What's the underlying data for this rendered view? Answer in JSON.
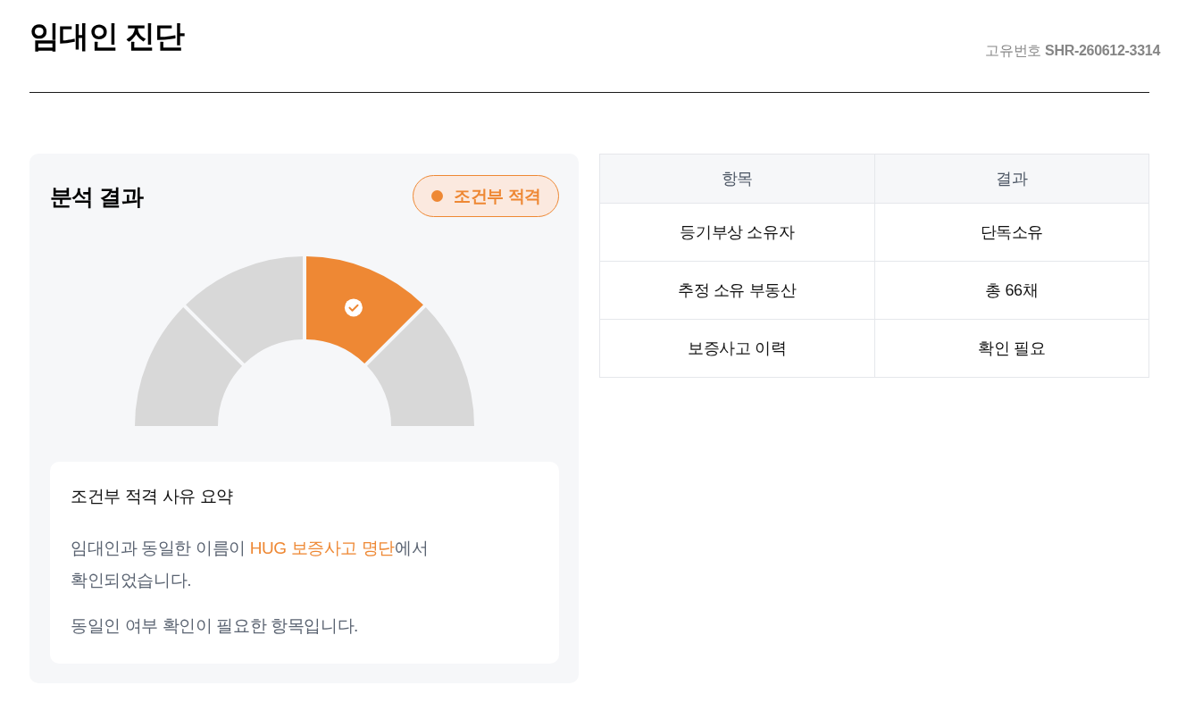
{
  "header": {
    "title": "임대인 진단",
    "reference": "고유번호 **SHR-260612-3314**"
  },
  "analysis": {
    "title": "분석 결과",
    "status": {
      "label": "조건부 적격",
      "kind": "conditional"
    },
    "gauge": {
      "segments": [
        {
          "selected": false
        },
        {
          "selected": false
        },
        {
          "selected": true
        },
        {
          "selected": false
        }
      ]
    },
    "summary": {
      "title": "조건부 적격 사유 요약",
      "paragraphs": [
        [
          {
            "text": "임대인과 동일한 이름이 ",
            "highlight": false
          },
          {
            "text": "HUG 보증사고 명단",
            "highlight": true
          },
          {
            "text": "에서 확인되었습니다.",
            "highlight": false
          }
        ],
        [
          {
            "text": "동일인 여부 확인이 필요한 항목입니다.",
            "highlight": false
          }
        ]
      ]
    }
  },
  "table": {
    "columns": [
      "항목",
      "결과"
    ],
    "rows": [
      [
        "등기부상 소유자",
        "단독소유"
      ],
      [
        "추정 소유 부동산",
        "총 66채"
      ],
      [
        "보증사고 이력",
        "확인 필요"
      ]
    ]
  }
}
